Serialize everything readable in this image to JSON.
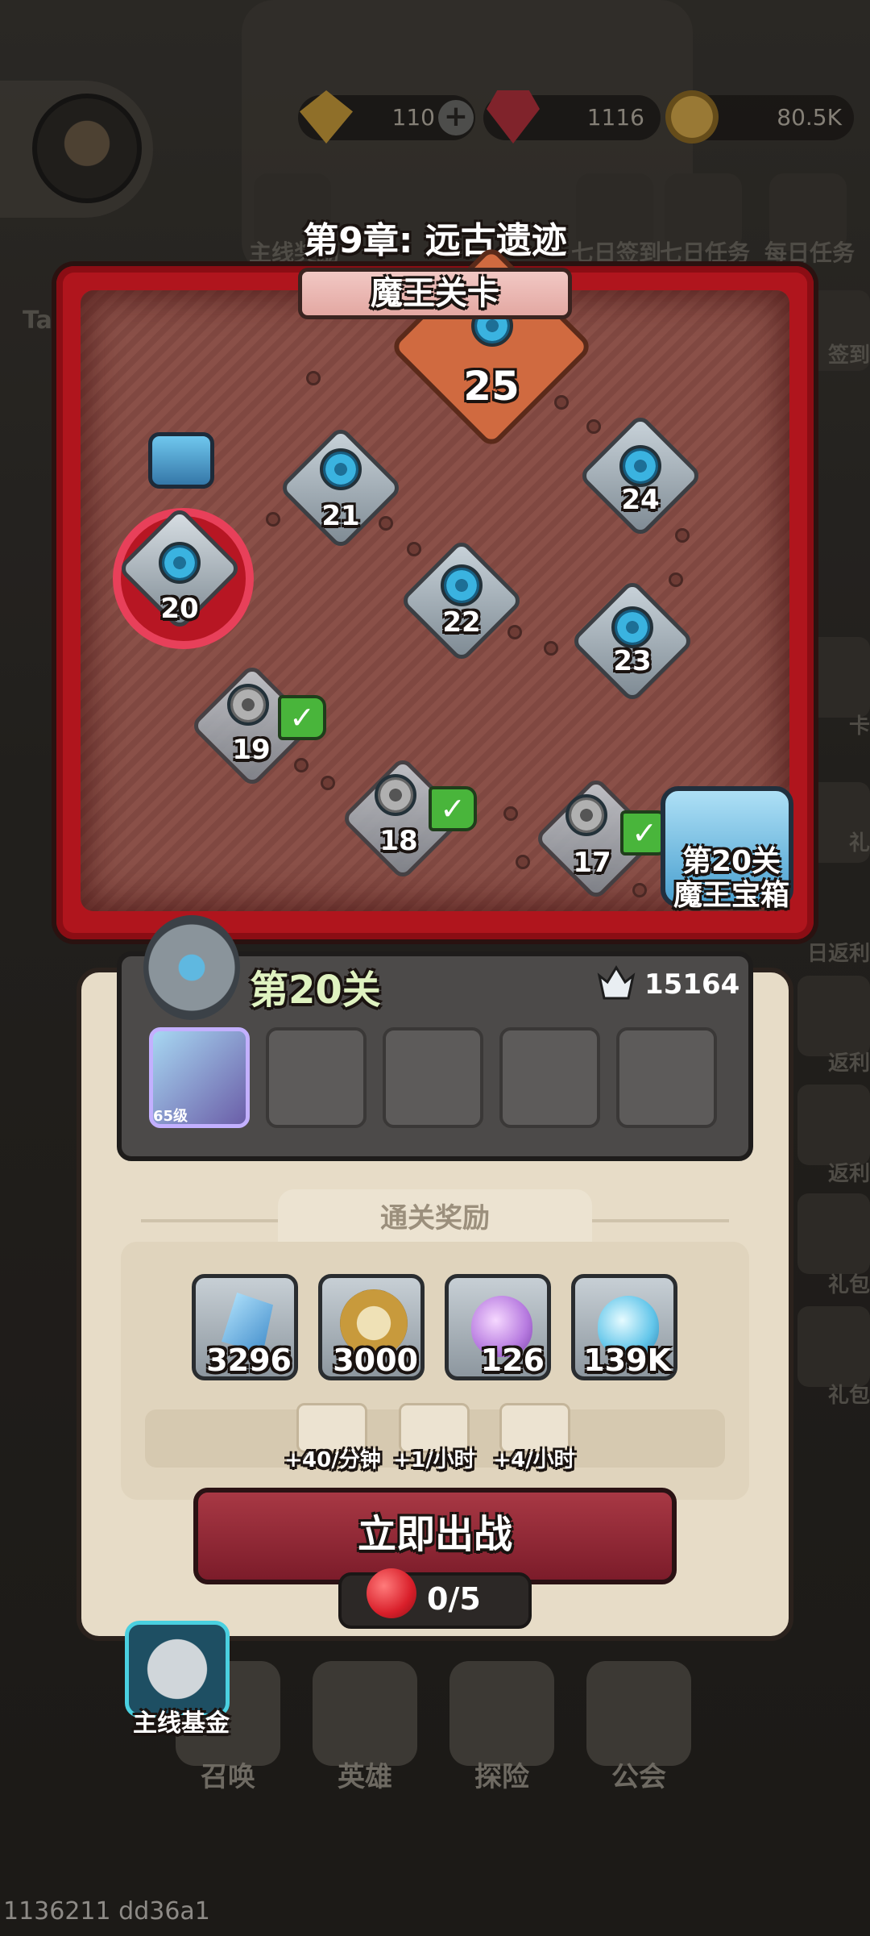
{
  "resources": [
    {
      "name": "gold-bar-icon",
      "value": "110"
    },
    {
      "name": "red-gem-icon",
      "value": "1116"
    },
    {
      "name": "coin-icon",
      "value": "80.5K"
    }
  ],
  "top_nav": [
    "主线奖励",
    "七日签到",
    "七日任务",
    "每日任务"
  ],
  "side_left": [
    "Ta"
  ],
  "side_right": [
    "签到",
    "卡",
    "礼",
    "日返利",
    "返利",
    "返利",
    "礼包",
    "礼包"
  ],
  "chapter_title": "第9章: 远古遗迹",
  "boss_banner": "魔王关卡",
  "map": {
    "boss_node": "25",
    "nodes": [
      "21",
      "24",
      "20",
      "22",
      "23",
      "19",
      "18",
      "17"
    ],
    "boss_chest_label_1": "第20关",
    "boss_chest_label_2": "魔王宝箱"
  },
  "stage": {
    "title": "第20关",
    "power": "15164",
    "hero_level": "65级"
  },
  "rewards": {
    "title": "通关奖励",
    "items": [
      {
        "icon": "blue-crystal-icon",
        "value": "3296"
      },
      {
        "icon": "coin-icon",
        "value": "3000"
      },
      {
        "icon": "purple-potion-icon",
        "value": "126"
      },
      {
        "icon": "blue-potion-icon",
        "value": "139K"
      }
    ],
    "rates": [
      {
        "icon": "blue-potion-up-icon",
        "value": "+40/分钟"
      },
      {
        "icon": "purple-potion-up-icon",
        "value": "+1/小时"
      },
      {
        "icon": "crystal-up-icon",
        "value": "+4/小时"
      }
    ]
  },
  "fight_button": "立即出战",
  "stamina": "0/5",
  "fund_label": "主线基金",
  "bottom_nav": [
    "召唤",
    "英雄",
    "探险",
    "公会"
  ],
  "debug_text": "1136211 dd36a1"
}
